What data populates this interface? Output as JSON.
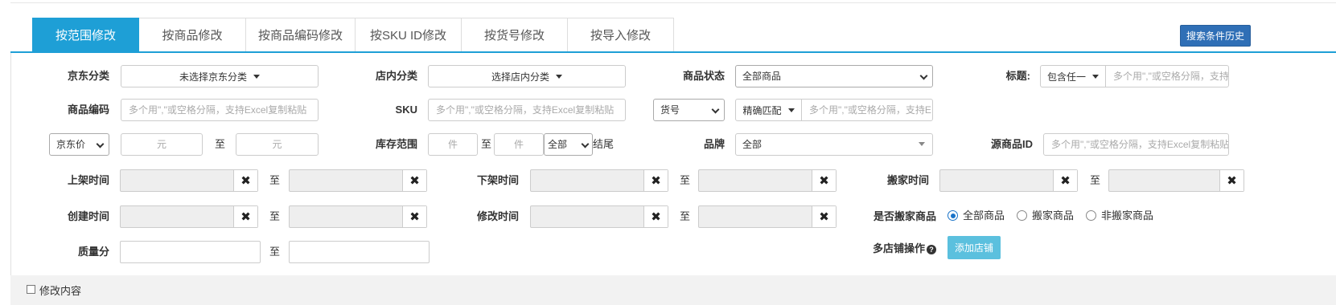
{
  "tabs": [
    {
      "label": "按范围修改",
      "active": true
    },
    {
      "label": "按商品修改",
      "active": false
    },
    {
      "label": "按商品编码修改",
      "active": false
    },
    {
      "label": "按SKU ID修改",
      "active": false
    },
    {
      "label": "按货号修改",
      "active": false
    },
    {
      "label": "按导入修改",
      "active": false
    }
  ],
  "history_button": "搜索条件历史",
  "form": {
    "jd_category": {
      "label": "京东分类",
      "value": "未选择京东分类"
    },
    "shop_category": {
      "label": "店内分类",
      "value": "选择店内分类"
    },
    "product_status": {
      "label": "商品状态",
      "value": "全部商品"
    },
    "title": {
      "label": "标题:",
      "mode": "包含任一",
      "placeholder": "多个用\",\"或空格分隔，支持"
    },
    "product_code": {
      "label": "商品编码",
      "placeholder": "多个用\",\"或空格分隔，支持Excel复制粘贴"
    },
    "sku": {
      "label": "SKU",
      "placeholder": "多个用\",\"或空格分隔，支持Excel复制粘贴"
    },
    "item_no": {
      "select": "货号",
      "match": "精确匹配",
      "placeholder": "多个用\",\"或空格分隔，支持E"
    },
    "price": {
      "select": "京东价",
      "min_placeholder": "元",
      "to": "至",
      "max_placeholder": "元"
    },
    "stock": {
      "label": "库存范围",
      "min_placeholder": "件",
      "to": "至",
      "max_placeholder": "件",
      "tail_select": "全部",
      "tail_label": "结尾"
    },
    "brand": {
      "label": "品牌",
      "value": "全部"
    },
    "source_id": {
      "label": "源商品ID",
      "placeholder": "多个用\",\"或空格分隔，支持Excel复制粘贴"
    },
    "listed_time": {
      "label": "上架时间",
      "to": "至"
    },
    "delisted_time": {
      "label": "下架时间",
      "to": "至"
    },
    "moved_time": {
      "label": "搬家时间",
      "to": "至"
    },
    "created_time": {
      "label": "创建时间",
      "to": "至"
    },
    "modified_time": {
      "label": "修改时间",
      "to": "至"
    },
    "is_moved": {
      "label": "是否搬家商品",
      "options": [
        "全部商品",
        "搬家商品",
        "非搬家商品"
      ],
      "selected": 0
    },
    "quality": {
      "label": "质量分",
      "to": "至"
    },
    "multi_shop": {
      "label": "多店铺操作",
      "button": "添加店铺"
    }
  },
  "footer_text": "修改内容"
}
